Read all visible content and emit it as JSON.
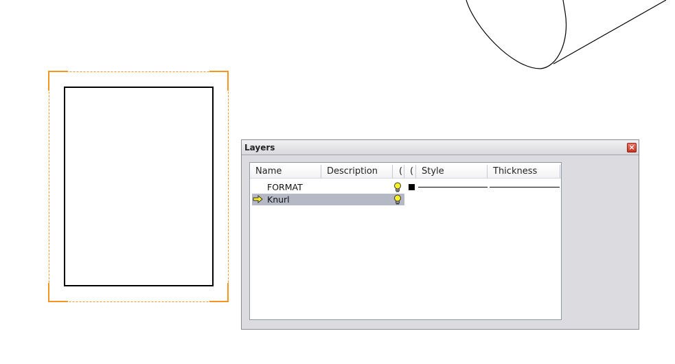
{
  "dialog": {
    "title": "Layers",
    "close_label": "×"
  },
  "table": {
    "columns": [
      {
        "label": "Name"
      },
      {
        "label": "Description"
      },
      {
        "label": "("
      },
      {
        "label": "("
      },
      {
        "label": "Style"
      },
      {
        "label": "Thickness"
      }
    ],
    "rows": [
      {
        "name": "FORMAT",
        "description": "",
        "visible_icon": "lightbulb-icon",
        "color": "#000000",
        "style": "solid",
        "thickness": "thin",
        "active": false,
        "selected": false
      },
      {
        "name": "Knurl",
        "description": "",
        "visible_icon": "lightbulb-icon",
        "active": true,
        "selected": true
      }
    ]
  },
  "colors": {
    "selection_orange": "#f7941d",
    "selected_row": "#b5b9c6",
    "dialog_bg": "#dcdce0"
  }
}
